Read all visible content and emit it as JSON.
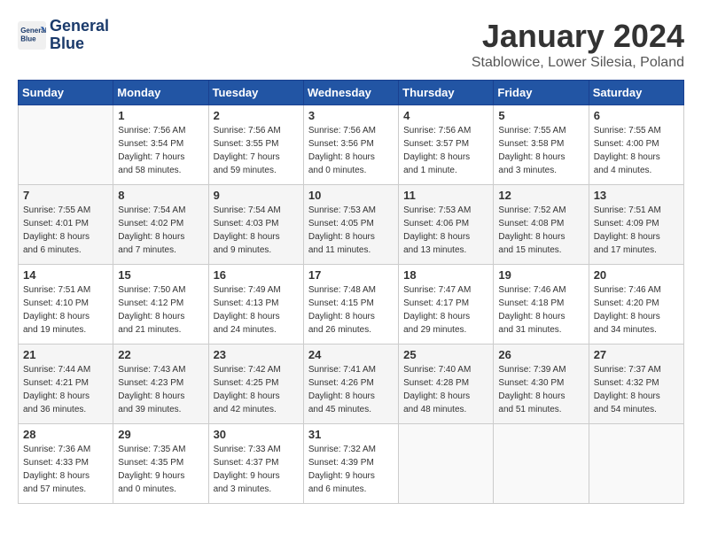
{
  "header": {
    "logo_line1": "General",
    "logo_line2": "Blue",
    "month": "January 2024",
    "location": "Stablowice, Lower Silesia, Poland"
  },
  "days_of_week": [
    "Sunday",
    "Monday",
    "Tuesday",
    "Wednesday",
    "Thursday",
    "Friday",
    "Saturday"
  ],
  "weeks": [
    [
      {
        "day": "",
        "info": ""
      },
      {
        "day": "1",
        "info": "Sunrise: 7:56 AM\nSunset: 3:54 PM\nDaylight: 7 hours\nand 58 minutes."
      },
      {
        "day": "2",
        "info": "Sunrise: 7:56 AM\nSunset: 3:55 PM\nDaylight: 7 hours\nand 59 minutes."
      },
      {
        "day": "3",
        "info": "Sunrise: 7:56 AM\nSunset: 3:56 PM\nDaylight: 8 hours\nand 0 minutes."
      },
      {
        "day": "4",
        "info": "Sunrise: 7:56 AM\nSunset: 3:57 PM\nDaylight: 8 hours\nand 1 minute."
      },
      {
        "day": "5",
        "info": "Sunrise: 7:55 AM\nSunset: 3:58 PM\nDaylight: 8 hours\nand 3 minutes."
      },
      {
        "day": "6",
        "info": "Sunrise: 7:55 AM\nSunset: 4:00 PM\nDaylight: 8 hours\nand 4 minutes."
      }
    ],
    [
      {
        "day": "7",
        "info": "Sunrise: 7:55 AM\nSunset: 4:01 PM\nDaylight: 8 hours\nand 6 minutes."
      },
      {
        "day": "8",
        "info": "Sunrise: 7:54 AM\nSunset: 4:02 PM\nDaylight: 8 hours\nand 7 minutes."
      },
      {
        "day": "9",
        "info": "Sunrise: 7:54 AM\nSunset: 4:03 PM\nDaylight: 8 hours\nand 9 minutes."
      },
      {
        "day": "10",
        "info": "Sunrise: 7:53 AM\nSunset: 4:05 PM\nDaylight: 8 hours\nand 11 minutes."
      },
      {
        "day": "11",
        "info": "Sunrise: 7:53 AM\nSunset: 4:06 PM\nDaylight: 8 hours\nand 13 minutes."
      },
      {
        "day": "12",
        "info": "Sunrise: 7:52 AM\nSunset: 4:08 PM\nDaylight: 8 hours\nand 15 minutes."
      },
      {
        "day": "13",
        "info": "Sunrise: 7:51 AM\nSunset: 4:09 PM\nDaylight: 8 hours\nand 17 minutes."
      }
    ],
    [
      {
        "day": "14",
        "info": "Sunrise: 7:51 AM\nSunset: 4:10 PM\nDaylight: 8 hours\nand 19 minutes."
      },
      {
        "day": "15",
        "info": "Sunrise: 7:50 AM\nSunset: 4:12 PM\nDaylight: 8 hours\nand 21 minutes."
      },
      {
        "day": "16",
        "info": "Sunrise: 7:49 AM\nSunset: 4:13 PM\nDaylight: 8 hours\nand 24 minutes."
      },
      {
        "day": "17",
        "info": "Sunrise: 7:48 AM\nSunset: 4:15 PM\nDaylight: 8 hours\nand 26 minutes."
      },
      {
        "day": "18",
        "info": "Sunrise: 7:47 AM\nSunset: 4:17 PM\nDaylight: 8 hours\nand 29 minutes."
      },
      {
        "day": "19",
        "info": "Sunrise: 7:46 AM\nSunset: 4:18 PM\nDaylight: 8 hours\nand 31 minutes."
      },
      {
        "day": "20",
        "info": "Sunrise: 7:46 AM\nSunset: 4:20 PM\nDaylight: 8 hours\nand 34 minutes."
      }
    ],
    [
      {
        "day": "21",
        "info": "Sunrise: 7:44 AM\nSunset: 4:21 PM\nDaylight: 8 hours\nand 36 minutes."
      },
      {
        "day": "22",
        "info": "Sunrise: 7:43 AM\nSunset: 4:23 PM\nDaylight: 8 hours\nand 39 minutes."
      },
      {
        "day": "23",
        "info": "Sunrise: 7:42 AM\nSunset: 4:25 PM\nDaylight: 8 hours\nand 42 minutes."
      },
      {
        "day": "24",
        "info": "Sunrise: 7:41 AM\nSunset: 4:26 PM\nDaylight: 8 hours\nand 45 minutes."
      },
      {
        "day": "25",
        "info": "Sunrise: 7:40 AM\nSunset: 4:28 PM\nDaylight: 8 hours\nand 48 minutes."
      },
      {
        "day": "26",
        "info": "Sunrise: 7:39 AM\nSunset: 4:30 PM\nDaylight: 8 hours\nand 51 minutes."
      },
      {
        "day": "27",
        "info": "Sunrise: 7:37 AM\nSunset: 4:32 PM\nDaylight: 8 hours\nand 54 minutes."
      }
    ],
    [
      {
        "day": "28",
        "info": "Sunrise: 7:36 AM\nSunset: 4:33 PM\nDaylight: 8 hours\nand 57 minutes."
      },
      {
        "day": "29",
        "info": "Sunrise: 7:35 AM\nSunset: 4:35 PM\nDaylight: 9 hours\nand 0 minutes."
      },
      {
        "day": "30",
        "info": "Sunrise: 7:33 AM\nSunset: 4:37 PM\nDaylight: 9 hours\nand 3 minutes."
      },
      {
        "day": "31",
        "info": "Sunrise: 7:32 AM\nSunset: 4:39 PM\nDaylight: 9 hours\nand 6 minutes."
      },
      {
        "day": "",
        "info": ""
      },
      {
        "day": "",
        "info": ""
      },
      {
        "day": "",
        "info": ""
      }
    ]
  ]
}
